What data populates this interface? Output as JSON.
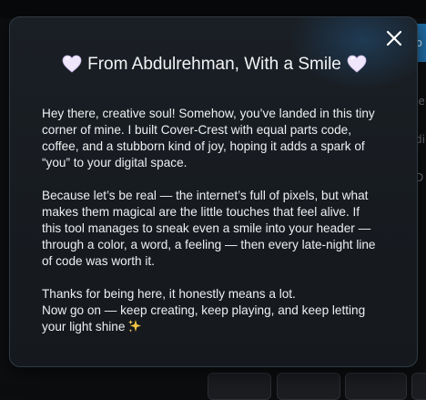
{
  "modal": {
    "title": "From Abdulrehman, With a Smile",
    "close_label": "×",
    "paragraph_1": [
      "Hey there, creative soul! Somehow, you’ve landed in this tiny",
      "corner of mine. I built Cover-Crest with equal parts code,",
      "coffee, and a stubborn kind of joy, hoping it adds a spark of",
      "“you” to your digital space."
    ],
    "paragraph_2": [
      "Because let’s be real — the internet’s full of pixels, but what",
      "makes them magical are the little touches that feel alive. If",
      "this tool manages to sneak even a smile into your header —",
      "through a color, a word, a feeling — then every late-night line",
      "of code was worth it."
    ],
    "paragraph_3": [
      "Thanks for being here, it honestly means a lot.",
      "Now go on — keep creating, keep playing, and keep letting",
      "your light shine"
    ]
  },
  "background": {
    "blue_tab_text": "ro",
    "side_fragments": [
      "le",
      "di",
      "D"
    ]
  },
  "icons": {
    "title_left": "white-heart-icon",
    "title_right": "white-heart-icon",
    "close": "close-icon",
    "sparkle": "sparkles-icon"
  },
  "colors": {
    "accent_blue": "#1f6fa8",
    "heart_fill": "#efe6fb",
    "sparkle": "#f4c542"
  }
}
